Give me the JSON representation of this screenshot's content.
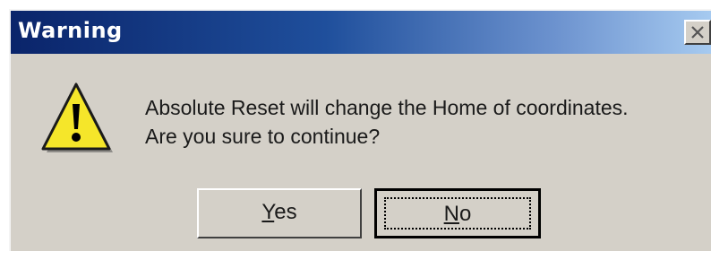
{
  "dialog": {
    "title": "Warning",
    "message_line1": "Absolute Reset will change the Home of coordinates.",
    "message_line2": "Are you sure to continue?",
    "icon": "warning-triangle-icon",
    "close_icon": "close-icon",
    "buttons": {
      "yes_mnemonic": "Y",
      "yes_rest": "es",
      "no_mnemonic": "N",
      "no_rest": "o"
    },
    "colors": {
      "titlebar_start": "#0a246a",
      "titlebar_end": "#a6caf0",
      "face": "#d4d0c8",
      "warning_yellow": "#f5e62a"
    }
  }
}
